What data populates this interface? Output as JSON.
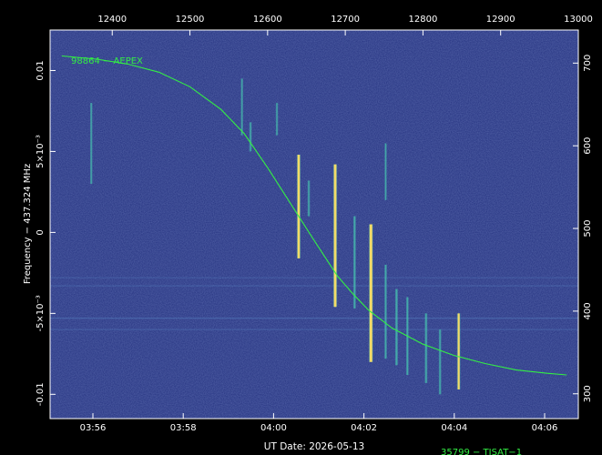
{
  "chart_data": {
    "type": "line",
    "background": "waterfall spectrogram",
    "colors": {
      "page": "#000000",
      "field": "#2c3a86",
      "field_noise": "#3a4a9c",
      "axis_text": "#ffffff",
      "trace": "#33ee44",
      "label": "#33ee44",
      "burst_core": "#ffe066",
      "burst_edge": "#47c2b0",
      "hline": "#5a8ac8"
    },
    "x_bottom": {
      "label": "UT Date: 2026-05-13",
      "ticks": [
        "03:56",
        "03:58",
        "04:00",
        "04:02",
        "04:04",
        "04:06"
      ]
    },
    "x_top": {
      "ticks": [
        "12400",
        "12500",
        "12600",
        "12700",
        "12800",
        "12900",
        "13000"
      ],
      "range": [
        12320,
        13000
      ]
    },
    "y_left": {
      "label": "Frequency − 437.324 MHz",
      "ticks": [
        "-0.01",
        "-5×10⁻³",
        "0",
        "5×10⁻³",
        "0.01"
      ],
      "tick_values": [
        -0.01,
        -0.005,
        0,
        0.005,
        0.01
      ],
      "range": [
        -0.0115,
        0.0125
      ]
    },
    "y_right": {
      "ticks": [
        "300",
        "400",
        "500",
        "600",
        "700"
      ],
      "tick_values": [
        300,
        400,
        500,
        600,
        700
      ],
      "range": [
        270,
        740
      ]
    },
    "series": [
      {
        "name": "98864 − AEPEX",
        "x": [
          12335,
          12380,
          12420,
          12460,
          12500,
          12540,
          12570,
          12600,
          12620,
          12640,
          12660,
          12675,
          12690,
          12710,
          12730,
          12760,
          12800,
          12840,
          12880,
          12920,
          12960,
          12985
        ],
        "y": [
          0.0109,
          0.0107,
          0.0104,
          0.0099,
          0.009,
          0.0076,
          0.0061,
          0.004,
          0.0025,
          0.001,
          -0.0005,
          -0.0016,
          -0.0027,
          -0.0038,
          -0.0048,
          -0.0059,
          -0.0069,
          -0.0076,
          -0.0081,
          -0.0085,
          -0.0087,
          -0.0088
        ]
      }
    ],
    "annotations": [
      "35799 − TISAT−1"
    ]
  }
}
